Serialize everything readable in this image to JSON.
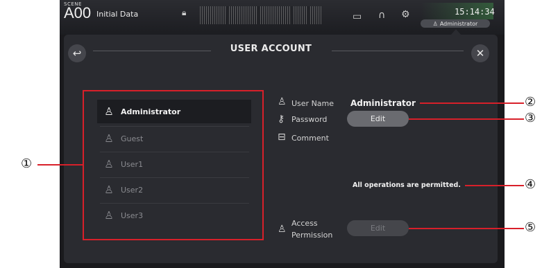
{
  "status_bar": {
    "scene_label": "SCENE",
    "scene_number": "A00",
    "scene_name": "Initial Data",
    "time": "15:14:34",
    "user_badge": "Administrator",
    "icons": [
      "lock-icon",
      "level-meter",
      "recorder-icon",
      "headphones-icon",
      "gear-icon"
    ]
  },
  "dialog": {
    "title": "USER ACCOUNT",
    "back_glyph": "↩",
    "close_glyph": "✕"
  },
  "user_list": [
    {
      "label": "Administrator",
      "selected": true
    },
    {
      "label": "Guest",
      "selected": false
    },
    {
      "label": "User1",
      "selected": false
    },
    {
      "label": "User2",
      "selected": false
    },
    {
      "label": "User3",
      "selected": false
    }
  ],
  "fields": {
    "user_name_label": "User Name",
    "user_name_value": "Administrator",
    "password_label": "Password",
    "password_button": "Edit",
    "comment_label": "Comment",
    "comment_value": "All operations are permitted.",
    "access_label_line1": "Access",
    "access_label_line2": "Permission",
    "access_button": "Edit"
  },
  "callouts": [
    "①",
    "②",
    "③",
    "④",
    "⑤"
  ],
  "colors": {
    "callout_red": "#d8202a",
    "window_bg": "#2a2b30",
    "selected_row_bg": "#1c1d21"
  }
}
